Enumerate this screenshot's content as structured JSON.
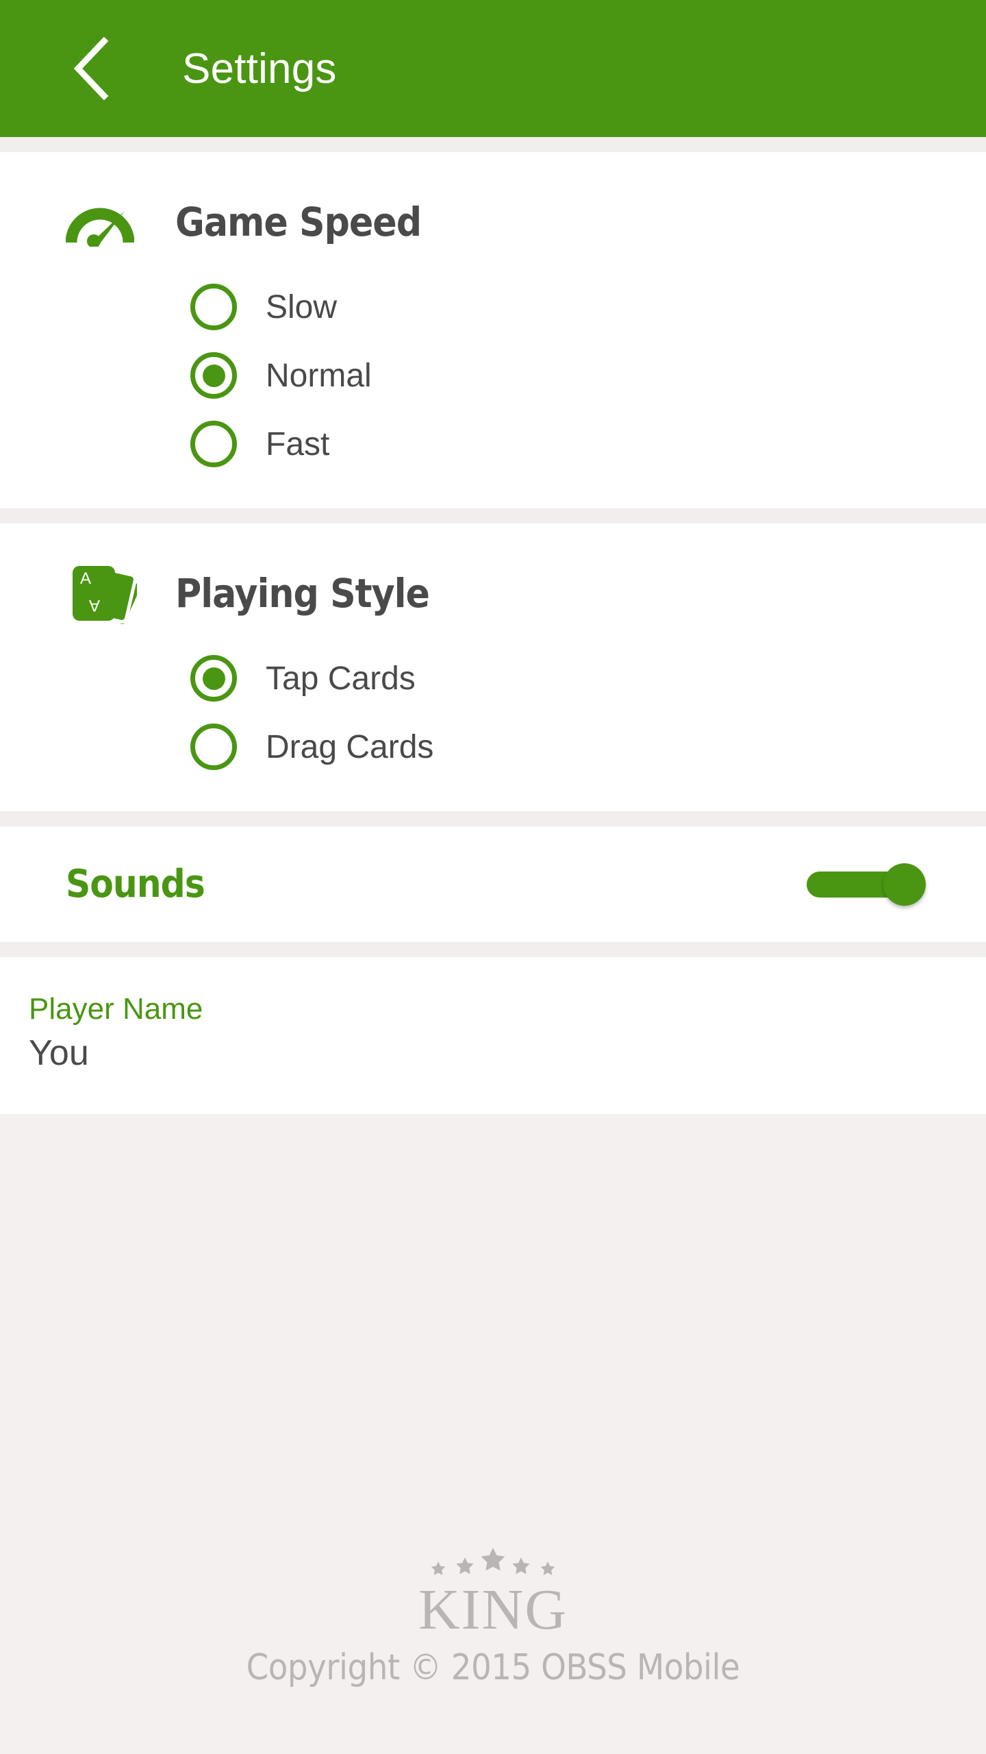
{
  "colors": {
    "brand_green": "#4a9613",
    "header_green": "#4a9613",
    "page_background": "#f3f0ef",
    "card_background": "#ffffff",
    "divider": "#f1eeed",
    "text_dark": "#4a4a4a",
    "text_muted": "#b9b5b3"
  },
  "header": {
    "back_icon": "chevron-left-icon",
    "title": "Settings"
  },
  "sections": {
    "game_speed": {
      "icon": "speedometer-icon",
      "title": "Game Speed",
      "options": [
        {
          "label": "Slow",
          "selected": false
        },
        {
          "label": "Normal",
          "selected": true
        },
        {
          "label": "Fast",
          "selected": false
        }
      ]
    },
    "playing_style": {
      "icon": "playing-cards-icon",
      "title": "Playing Style",
      "options": [
        {
          "label": "Tap Cards",
          "selected": true
        },
        {
          "label": "Drag Cards",
          "selected": false
        }
      ]
    },
    "sounds": {
      "label": "Sounds",
      "enabled": true
    },
    "player_name": {
      "label": "Player Name",
      "value": "You"
    }
  },
  "footer": {
    "stars_icon": "five-stars-icon",
    "logo_text": "KING",
    "copyright": "Copyright © 2015 OBSS Mobile"
  }
}
